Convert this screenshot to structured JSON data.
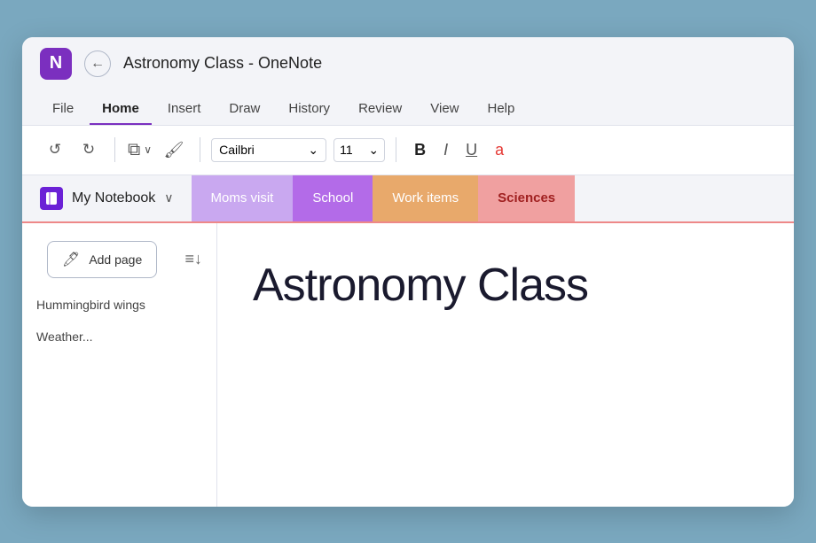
{
  "titleBar": {
    "appName": "Astronomy Class - OneNote",
    "onenoteLetterIcon": "N",
    "backButtonSymbol": "←"
  },
  "menuBar": {
    "items": [
      {
        "label": "File",
        "active": false
      },
      {
        "label": "Home",
        "active": true
      },
      {
        "label": "Insert",
        "active": false
      },
      {
        "label": "Draw",
        "active": false
      },
      {
        "label": "History",
        "active": false
      },
      {
        "label": "Review",
        "active": false
      },
      {
        "label": "View",
        "active": false
      },
      {
        "label": "Help",
        "active": false
      }
    ]
  },
  "toolbar": {
    "undoSymbol": "↺",
    "redoSymbol": "↻",
    "clipboardSymbol": "⧉",
    "clipboardChevron": "∨",
    "paintSymbol": "🖌",
    "fontName": "Cailbri",
    "fontChevron": "⌄",
    "fontSize": "11",
    "fontSizeChevron": "⌄",
    "boldLabel": "B",
    "italicLabel": "I",
    "underlineLabel": "U",
    "colorLabel": "a"
  },
  "notebookBar": {
    "notebookName": "My Notebook",
    "chevron": "∨",
    "tabs": [
      {
        "label": "Moms visit",
        "style": "moms"
      },
      {
        "label": "School",
        "style": "school"
      },
      {
        "label": "Work items",
        "style": "work"
      },
      {
        "label": "Sciences",
        "style": "sciences"
      }
    ]
  },
  "sidebar": {
    "addPageLabel": "Add page",
    "addPageIcon": "🖊",
    "sortIcon": "≡↓",
    "pages": [
      {
        "label": "Hummingbird wings"
      },
      {
        "label": "Weather..."
      }
    ]
  },
  "mainContent": {
    "pageTitle": "Astronomy Class"
  }
}
